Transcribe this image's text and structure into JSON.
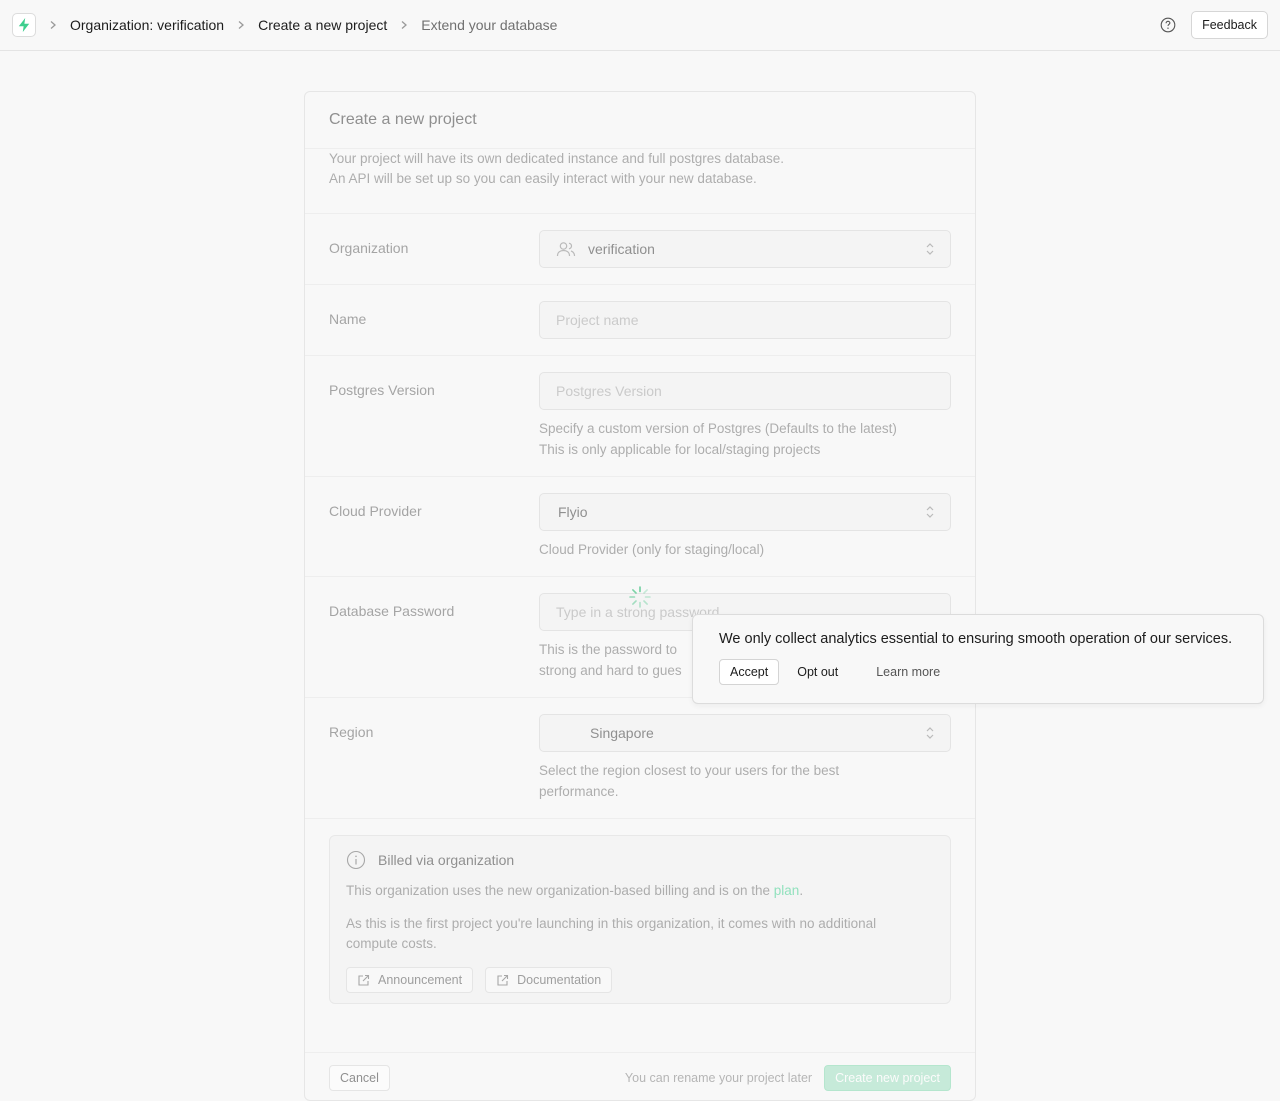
{
  "topbar": {
    "logo_icon": "bolt-icon",
    "breadcrumbs": [
      "Organization: verification",
      "Create a new project",
      "Extend your database"
    ],
    "feedback_label": "Feedback",
    "help_icon": "question-circle-icon"
  },
  "panel": {
    "title": "Create a new project",
    "intro_line1": "Your project will have its own dedicated instance and full postgres database.",
    "intro_line2": "An API will be set up so you can easily interact with your new database.",
    "organization": {
      "label": "Organization",
      "value": "verification",
      "icon": "users-icon"
    },
    "name": {
      "label": "Name",
      "placeholder": "Project name"
    },
    "postgres": {
      "label": "Postgres Version",
      "placeholder": "Postgres Version",
      "help_line1": "Specify a custom version of Postgres (Defaults to the latest)",
      "help_line2": "This is only applicable for local/staging projects"
    },
    "cloud": {
      "label": "Cloud Provider",
      "value": "Flyio",
      "help": "Cloud Provider (only for staging/local)"
    },
    "password": {
      "label": "Database Password",
      "placeholder": "Type in a strong password",
      "help_line1": "This is the password to",
      "help_line2": "strong and hard to gues"
    },
    "region": {
      "label": "Region",
      "value": "Singapore",
      "help_line1": "Select the region closest to your users for the best",
      "help_line2": "performance."
    },
    "billing": {
      "title": "Billed via organization",
      "p1_prefix": "This organization uses the new organization-based billing and is on the ",
      "p1_link": "plan",
      "p1_suffix": ".",
      "p2_line1": "As this is the first project you're launching in this organization, it comes with no additional",
      "p2_line2": "compute costs.",
      "announcement_label": "Announcement",
      "documentation_label": "Documentation"
    },
    "footer": {
      "cancel_label": "Cancel",
      "rename_note": "You can rename your project later",
      "create_label": "Create new project"
    }
  },
  "consent": {
    "text": "We only collect analytics essential to ensuring smooth operation of our services.",
    "accept_label": "Accept",
    "optout_label": "Opt out",
    "learn_label": "Learn more"
  },
  "colors": {
    "brand": "#3ecf8e"
  }
}
